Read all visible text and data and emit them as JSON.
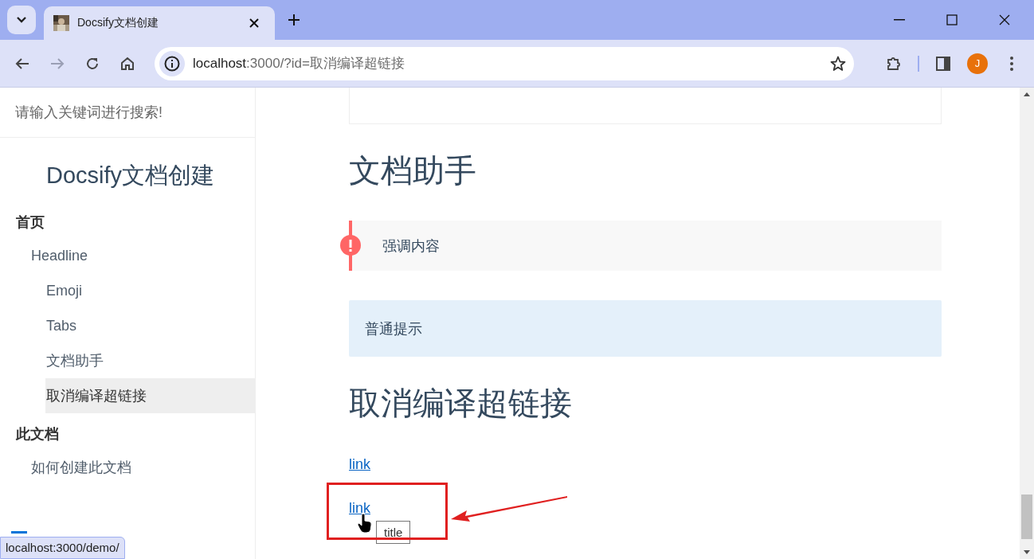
{
  "browser": {
    "tab_title": "Docsify文档创建",
    "url_host": "localhost",
    "url_rest": ":3000/?id=取消编译超链接",
    "avatar": "J"
  },
  "sidebar": {
    "search": {
      "placeholder": "请输入关键词进行搜索!"
    },
    "title": "Docsify文档创建",
    "groups": [
      {
        "label": "首页",
        "children": [
          {
            "label": "Headline",
            "selected": false,
            "children": [
              {
                "label": "Emoji",
                "selected": false
              },
              {
                "label": "Tabs",
                "selected": false
              },
              {
                "label": "文档助手",
                "selected": false
              },
              {
                "label": "取消编译超链接",
                "selected": true
              }
            ]
          }
        ]
      },
      {
        "label": "此文档",
        "children": [
          {
            "label": "如何创建此文档",
            "selected": false
          }
        ]
      }
    ]
  },
  "content": {
    "blocks": [
      {
        "kind": "tabbox"
      },
      {
        "kind": "heading",
        "text": "文档助手"
      },
      {
        "kind": "warn",
        "text": "强调内容"
      },
      {
        "kind": "tip",
        "text": "普通提示"
      },
      {
        "kind": "heading",
        "text": "取消编译超链接"
      },
      {
        "kind": "link",
        "text": "link"
      },
      {
        "kind": "link",
        "text": "link",
        "tooltip": "title"
      }
    ]
  },
  "status_url": "localhost:3000/demo/"
}
